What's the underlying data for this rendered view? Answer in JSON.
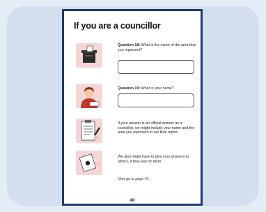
{
  "page_title": "If you are a councillor",
  "icons": {
    "ballot_box": "ballot-box-icon",
    "councillor": "councillor-person-icon",
    "report": "report-document-icon",
    "share": "share-handout-icon"
  },
  "questions": [
    {
      "label": "Question 18:",
      "text": " What is the name of the area that you represent?",
      "answer": ""
    },
    {
      "label": "Question 19:",
      "text": " What is your name?",
      "answer": ""
    }
  ],
  "notes": [
    "If your answer is an official answer as a councillor, we might include your name and the area you represent in our final report.",
    "We also might have to give your answers to others, if they ask for them."
  ],
  "go_to": "Now go to page 41.",
  "page_number": "40",
  "colors": {
    "frame": "#1e3a6b",
    "thumb_bg": "#f6d5d7",
    "accent_red": "#c0392b"
  }
}
